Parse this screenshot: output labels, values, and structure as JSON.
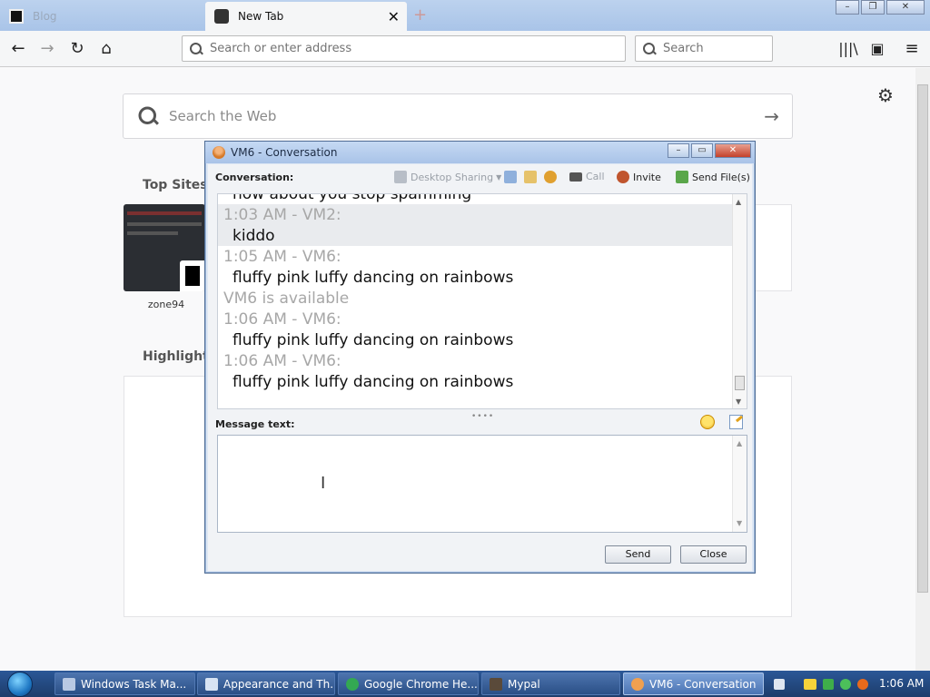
{
  "browser": {
    "tabs": [
      {
        "label": "Blog",
        "active": false
      },
      {
        "label": "New Tab",
        "active": true
      }
    ],
    "url_placeholder": "Search or enter address",
    "search_placeholder": "Search",
    "newtab": {
      "web_search_placeholder": "Search the Web",
      "top_sites_label": "Top Sites",
      "top_site_name": "zone94",
      "highlights_label": "Highlights"
    }
  },
  "dialog": {
    "title": "VM6 - Conversation",
    "conversation_label": "Conversation:",
    "toolbar": {
      "desktop_sharing": "Desktop Sharing",
      "call": "Call",
      "invite": "Invite",
      "send_files": "Send File(s)"
    },
    "lines": [
      {
        "kind": "msg",
        "text": "how about you stop spamming"
      },
      {
        "kind": "meta",
        "text": "1:03 AM - VM2:"
      },
      {
        "kind": "msg",
        "text": "kiddo"
      },
      {
        "kind": "meta",
        "text": "1:05 AM - VM6:"
      },
      {
        "kind": "msg",
        "text": "fluffy pink luffy dancing on rainbows"
      },
      {
        "kind": "meta",
        "text": "VM6 is available"
      },
      {
        "kind": "meta",
        "text": "1:06 AM - VM6:"
      },
      {
        "kind": "msg",
        "text": "fluffy pink luffy dancing on rainbows"
      },
      {
        "kind": "meta",
        "text": "1:06 AM - VM6:"
      },
      {
        "kind": "msg",
        "text": "fluffy pink luffy dancing on rainbows"
      }
    ],
    "message_label": "Message text:",
    "message_value": "",
    "send_button": "Send",
    "close_button": "Close"
  },
  "taskbar": {
    "items": [
      {
        "label": "Windows Task Ma...",
        "icon": "task-manager-icon",
        "color": "#b9c9e3"
      },
      {
        "label": "Appearance and Th...",
        "icon": "control-panel-icon",
        "color": "#d7e3f3"
      },
      {
        "label": "Google Chrome He...",
        "icon": "chrome-help-icon",
        "color": "#33a852"
      },
      {
        "label": "Mypal",
        "icon": "mypal-icon",
        "color": "#5a4a3a"
      },
      {
        "label": "VM6 - Conversation",
        "icon": "conversation-icon",
        "color": "#f0a050",
        "active": true
      }
    ],
    "clock": "1:06 AM"
  }
}
